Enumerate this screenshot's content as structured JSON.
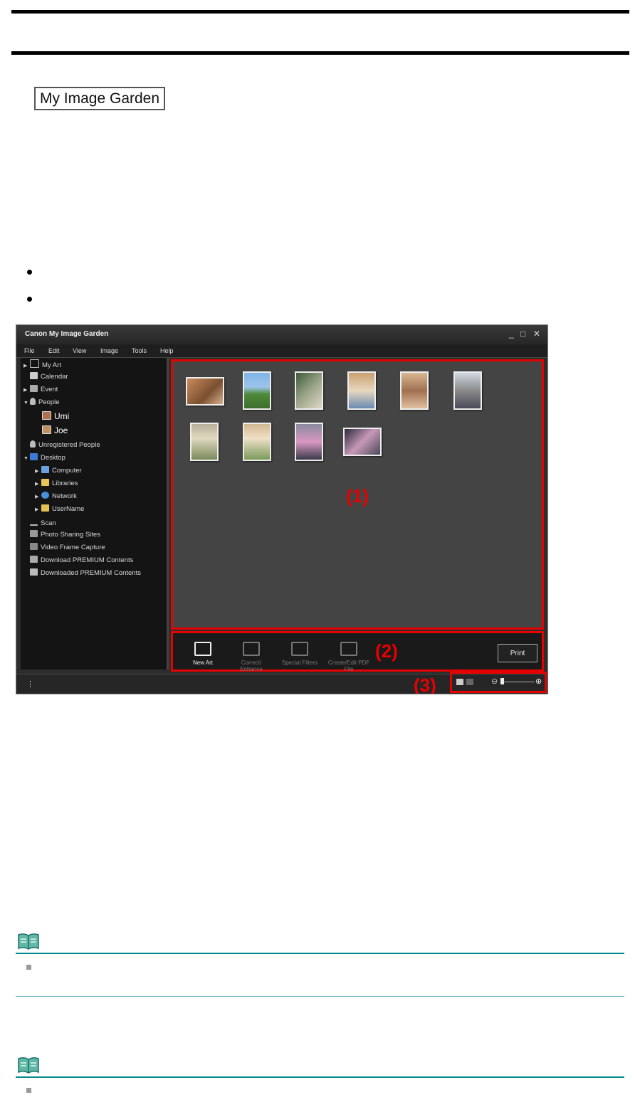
{
  "document": {
    "badge_label": "My Image Garden",
    "bullets": 2,
    "notes": 2
  },
  "app": {
    "title": "Canon My Image Garden",
    "window_buttons": {
      "minimize": "_",
      "maximize": "□",
      "close": "✕"
    },
    "menu": [
      "File",
      "Edit",
      "View",
      "Image",
      "Tools",
      "Help"
    ],
    "sidebar": [
      {
        "label": "My Art",
        "arrow": "▶",
        "icon": "my-art-icon"
      },
      {
        "label": "Calendar",
        "arrow": "",
        "icon": "calendar-icon"
      },
      {
        "label": "Event",
        "arrow": "▶",
        "icon": "event-icon"
      },
      {
        "label": "People",
        "arrow": "▼",
        "icon": "people-icon"
      },
      {
        "label": "Umi",
        "arrow": "",
        "icon": "person-photo-icon"
      },
      {
        "label": "Joe",
        "arrow": "",
        "icon": "person-photo-icon"
      },
      {
        "label": "Unregistered People",
        "arrow": "",
        "icon": "people-icon"
      },
      {
        "label": "Desktop",
        "arrow": "▼",
        "icon": "desktop-icon"
      },
      {
        "label": "Computer",
        "arrow": "▶",
        "icon": "computer-icon"
      },
      {
        "label": "Libraries",
        "arrow": "▶",
        "icon": "libraries-icon"
      },
      {
        "label": "Network",
        "arrow": "▶",
        "icon": "network-icon"
      },
      {
        "label": "UserName",
        "arrow": "▶",
        "icon": "user-folder-icon"
      },
      {
        "label": "Scan",
        "arrow": "",
        "icon": "scan-icon"
      },
      {
        "label": "Photo Sharing Sites",
        "arrow": "",
        "icon": "photo-sharing-icon"
      },
      {
        "label": "Video Frame Capture",
        "arrow": "",
        "icon": "video-frame-icon"
      },
      {
        "label": "Download PREMIUM Contents",
        "arrow": "",
        "icon": "download-icon"
      },
      {
        "label": "Downloaded PREMIUM Contents",
        "arrow": "",
        "icon": "folder-icon"
      }
    ],
    "thumbnails": 10,
    "area_labels": {
      "one": "(1)",
      "two": "(2)",
      "three": "(3)"
    },
    "actions": [
      {
        "label": "New Art",
        "enabled": true
      },
      {
        "label": "Correct/ Enhance",
        "enabled": false
      },
      {
        "label": "Special Filters",
        "enabled": false
      },
      {
        "label": "Create/Edit PDF File",
        "enabled": false
      }
    ],
    "print_label": "Print",
    "status_menu_glyph": "⋮",
    "zoom": {
      "minus": "⊖",
      "plus": "⊕"
    }
  }
}
